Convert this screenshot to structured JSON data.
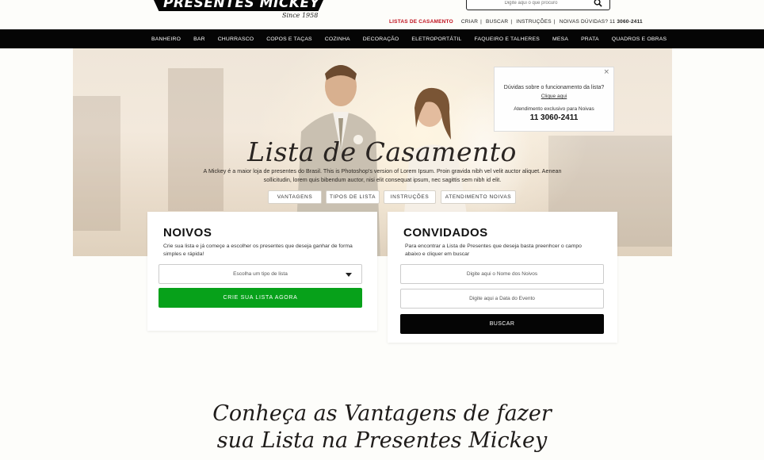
{
  "header": {
    "logo_text": "PRESENTES MICKEY",
    "logo_since": "Since 1958",
    "search_placeholder": "Digite aqui o que procuro",
    "toplinks": {
      "lista": "LISTAS DE CASAMENTO",
      "criar": "CRIAR",
      "buscar": "BUSCAR",
      "instrucoes": "INSTRUÇÕES",
      "duvidas": "NOIVAS DÚVIDAS? 11",
      "phone": "3060-2411"
    }
  },
  "nav": {
    "items": [
      "BANHEIRO",
      "BAR",
      "CHURRASCO",
      "COPOS E TAÇAS",
      "COZINHA",
      "DECORAÇÃO",
      "ELETROPORTÁTIL",
      "FAQUEIRO E TALHERES",
      "MESA",
      "PRATA",
      "QUADROS E OBRAS"
    ]
  },
  "info_box": {
    "close": "×",
    "question": "Dúvidas sobre o funcionamento da lista?",
    "link": "Clique aqui",
    "attendance": "Atendimento exclusivo para Noivas",
    "phone": "11 3060-2411"
  },
  "hero": {
    "title": "Lista de Casamento",
    "description": "A Mickey é a maior loja de presentes do Brasil. This is Photoshop's version  of Lorem Ipsum. Proin gravida nibh vel velit auctor aliquet. Aenean sollicitudin, lorem quis bibendum auctor, nisi elit consequat ipsum, nec sagittis sem nibh id elit.",
    "pills": [
      "VANTAGENS",
      "TIPOS DE LISTA",
      "INSTRUÇÕES",
      "ATENDIMENTO NOIVAS"
    ]
  },
  "noivos": {
    "title": "NOIVOS",
    "text": "Crie sua lista e já começe a escolher os presentes que deseja ganhar de forma simples e rápida!",
    "select_value": "Escolha um tipo de lista",
    "button": "CRIE SUA LISTA AGORA"
  },
  "convidados": {
    "title": "CONVIDADOS",
    "text": "Para encontrar a Lista de Presentes que deseja basta preenhcer o campo abaixo e cliquer em buscar",
    "field1_placeholder": "Digite aqui o Nome dos Noivos",
    "field2_placeholder": "Digite aqui a  Data do Evento",
    "button": "BUSCAR"
  },
  "bottom": {
    "line1": "Conheça as Vantagens de fazer",
    "line2": "sua Lista na Presentes Mickey"
  },
  "colors": {
    "nav_bg": "#050505",
    "accent_red": "#c0111e",
    "green": "#07a11a"
  }
}
